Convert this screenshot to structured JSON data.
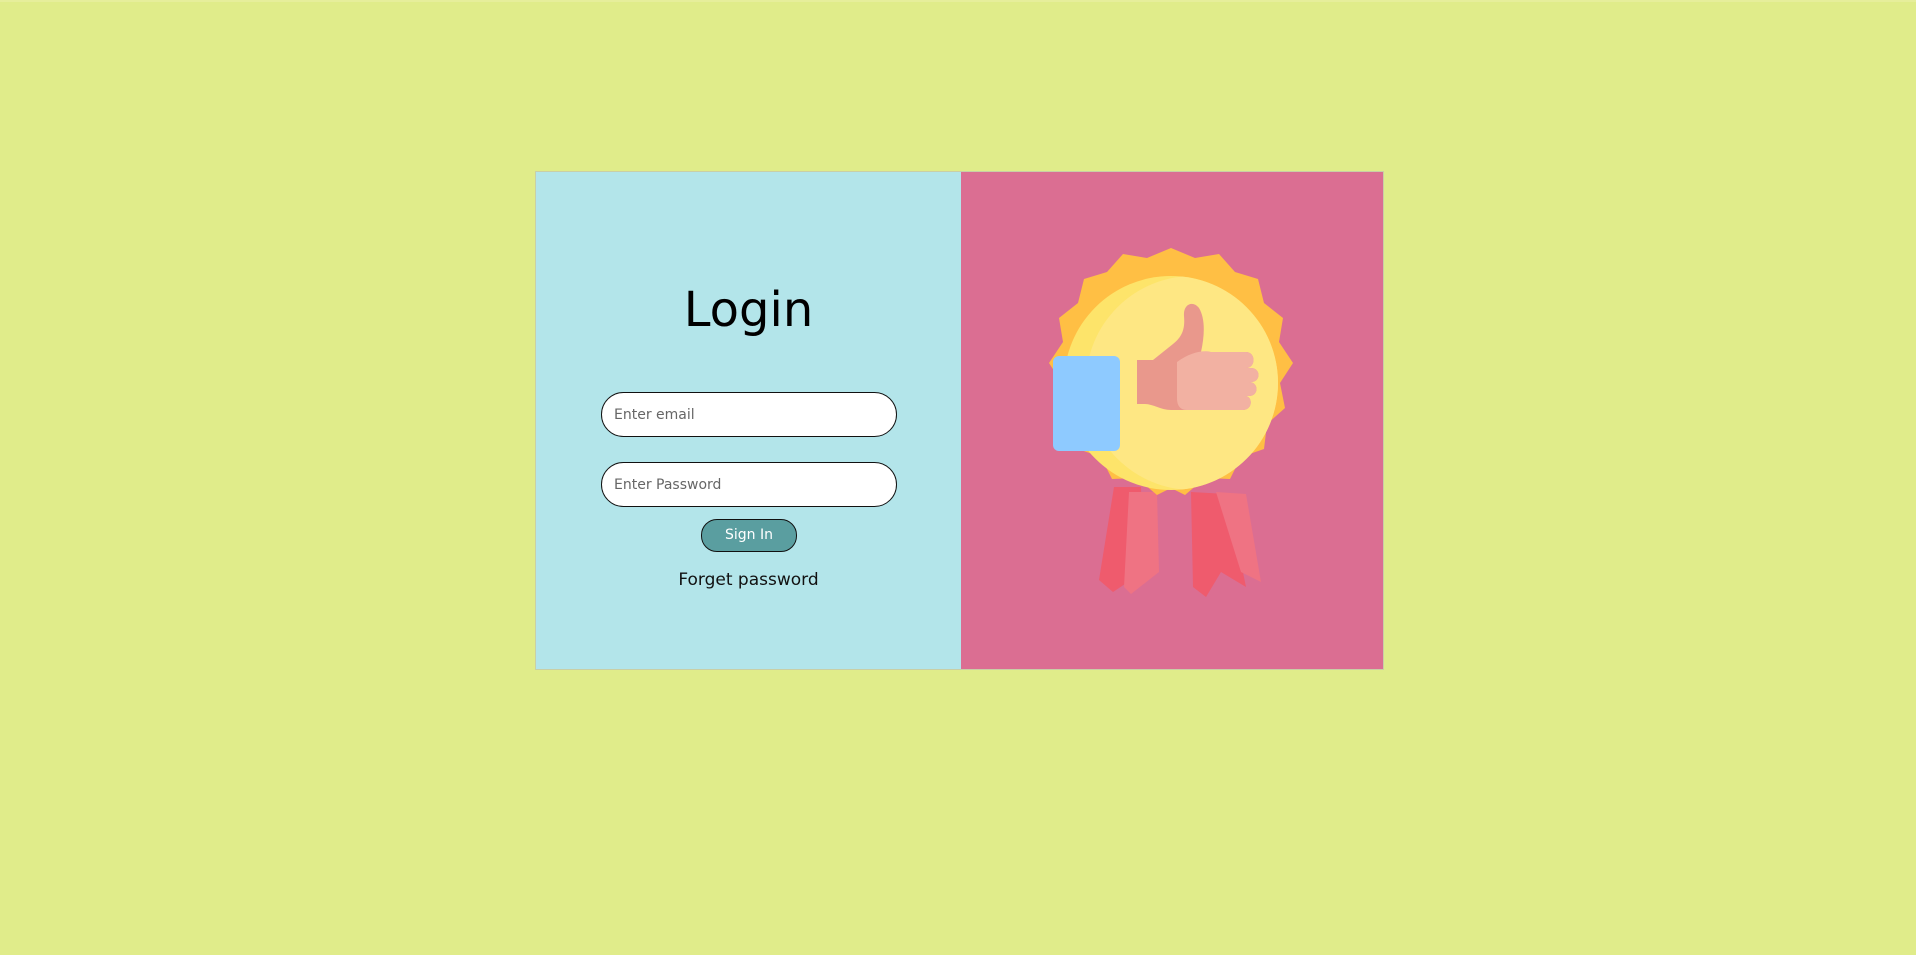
{
  "login": {
    "title": "Login",
    "email_placeholder": "Enter email",
    "password_placeholder": "Enter Password",
    "signin_label": "Sign In",
    "forget_label": "Forget password"
  },
  "colors": {
    "page_background": "#e0ec8a",
    "left_panel": "#b3e5ea",
    "right_panel": "#db6e92",
    "signin_button": "#5a9ea0"
  },
  "illustration": {
    "icon": "award-medal-thumbs-up-icon"
  }
}
